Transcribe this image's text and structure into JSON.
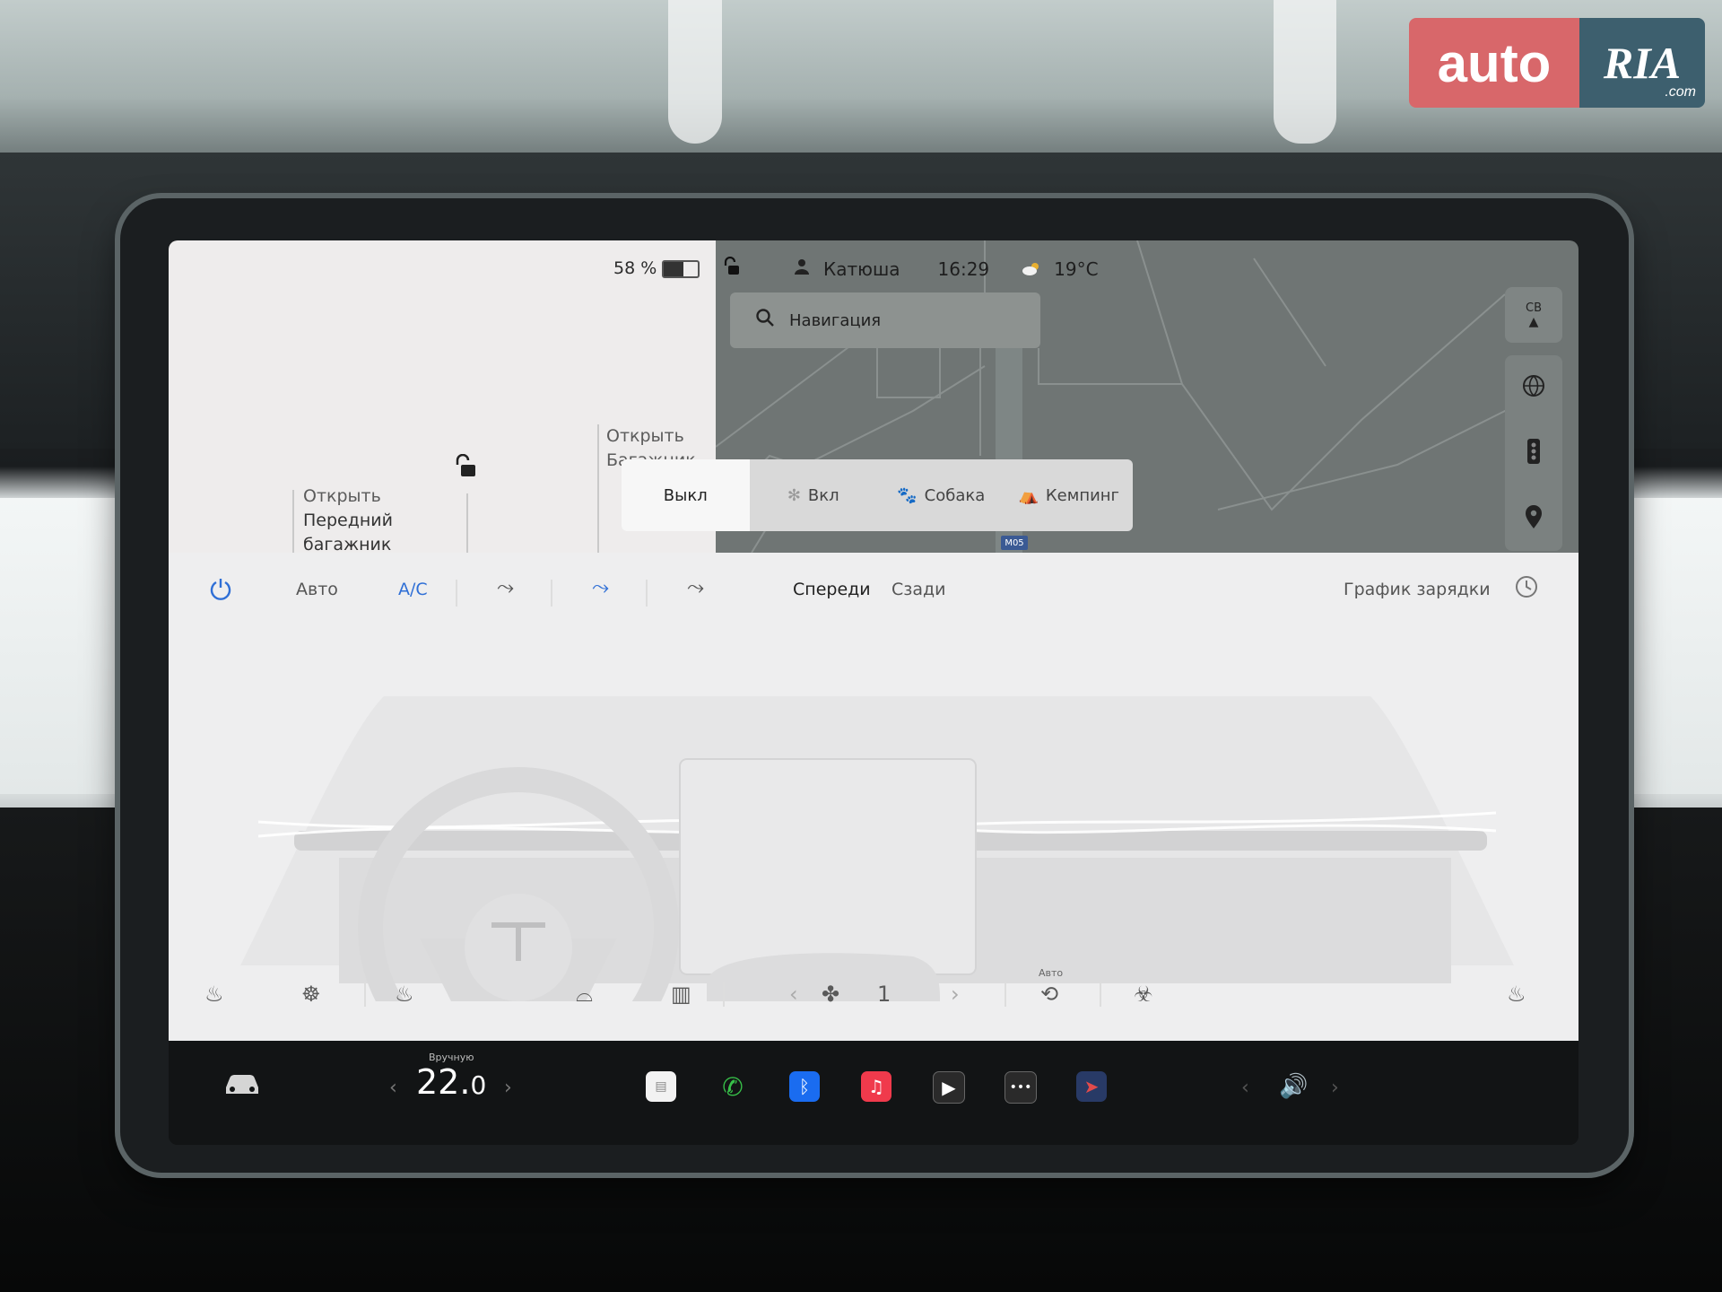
{
  "watermark": {
    "brand_left": "auto",
    "brand_right": "RIA",
    "brand_suffix": ".com"
  },
  "status_bar": {
    "battery_percent": "58 %",
    "battery_level": 0.58,
    "lock_icon": "unlocked-lock-icon",
    "profile_name": "Катюша",
    "time": "16:29",
    "weather_icon": "cloud-sun-icon",
    "temperature": "19°C"
  },
  "navigation": {
    "search_placeholder": "Навигация",
    "compass_label": "СВ",
    "road_badge": "M05",
    "side_buttons": [
      "globe-icon",
      "traffic-light-icon",
      "location-pin-icon"
    ]
  },
  "car_panel": {
    "rear_trunk": {
      "line1": "Открыть",
      "line2": "Багажник"
    },
    "front_trunk": {
      "line1": "Открыть",
      "line2": "Передний",
      "line3": "багажник"
    }
  },
  "climate_modes": {
    "options": [
      {
        "label": "Выкл",
        "icon": "",
        "selected": true
      },
      {
        "label": "Вкл",
        "icon": "fan-icon",
        "selected": false
      },
      {
        "label": "Собака",
        "icon": "paw-icon",
        "selected": false
      },
      {
        "label": "Кемпинг",
        "icon": "tent-icon",
        "selected": false
      }
    ]
  },
  "climate": {
    "auto_label": "Авто",
    "ac_label": "A/C",
    "front_tab": "Спереди",
    "rear_tab": "Сзади",
    "charging_schedule": "График зарядки",
    "fan_speed": "1",
    "recirc_auto_label": "Авто"
  },
  "taskbar": {
    "temp_mode": "Вручную",
    "temp_main": "22.",
    "temp_decimal": "0"
  },
  "colors": {
    "accent_blue": "#2f6fd6",
    "phone_green": "#37c049",
    "bluetooth_blue": "#1a6cf0",
    "music_red": "#f03a4c",
    "logo_red": "#d8676a",
    "logo_teal": "#3d5f6e"
  }
}
